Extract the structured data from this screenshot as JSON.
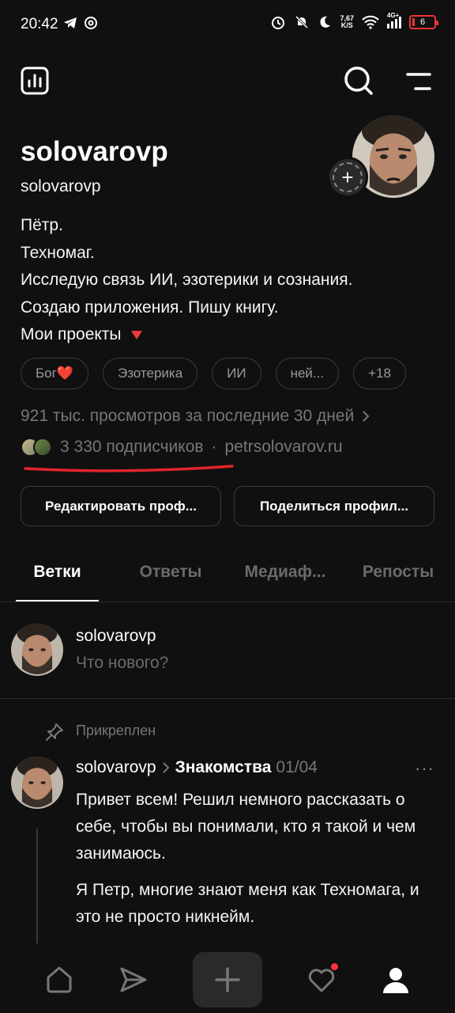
{
  "status_bar": {
    "time": "20:42",
    "net_speed_value": "7,67",
    "net_speed_unit": "K/S",
    "network": "4G+",
    "battery": "6"
  },
  "profile": {
    "display_name": "solovarovp",
    "handle": "solovarovp",
    "bio_lines": [
      "Пётр.",
      "Техномаг.",
      "Исследую связь ИИ, эзотерики и сознания.",
      "Создаю приложения. Пишу книгу."
    ],
    "bio_link_text": "Мои проекты",
    "add_story_symbol": "+"
  },
  "tags": [
    "Бог❤️",
    "Эзотерика",
    "ИИ",
    "ней...",
    "+18"
  ],
  "stats": {
    "views": "921 тыс. просмотров за последние 30 дней",
    "followers": "3 330 подписчиков",
    "separator": "·",
    "website": "petrsolovarov.ru"
  },
  "buttons": {
    "edit_profile": "Редактировать проф...",
    "share_profile": "Поделиться профил..."
  },
  "tabs": [
    "Ветки",
    "Ответы",
    "Медиаф...",
    "Репосты"
  ],
  "composer": {
    "username": "solovarovp",
    "placeholder": "Что нового?"
  },
  "post": {
    "pinned_label": "Прикреплен",
    "author": "solovarovp",
    "topic": "Знакомства",
    "date": "01/04",
    "more": "···",
    "paragraphs": [
      "Привет всем! Решил немного рассказать о себе, чтобы вы понимали, кто я такой и чем занимаюсь.",
      "Я Петр, многие знают меня как Техномага, и это не просто никнейм."
    ]
  },
  "colors": {
    "background": "#101010",
    "accent_red": "#ff3040",
    "underline_annotation": "#e0262a"
  },
  "icons": [
    "insights-icon",
    "search-icon",
    "menu-icon",
    "home-icon",
    "send-icon",
    "plus-icon",
    "heart-icon",
    "profile-icon",
    "pin-icon"
  ]
}
